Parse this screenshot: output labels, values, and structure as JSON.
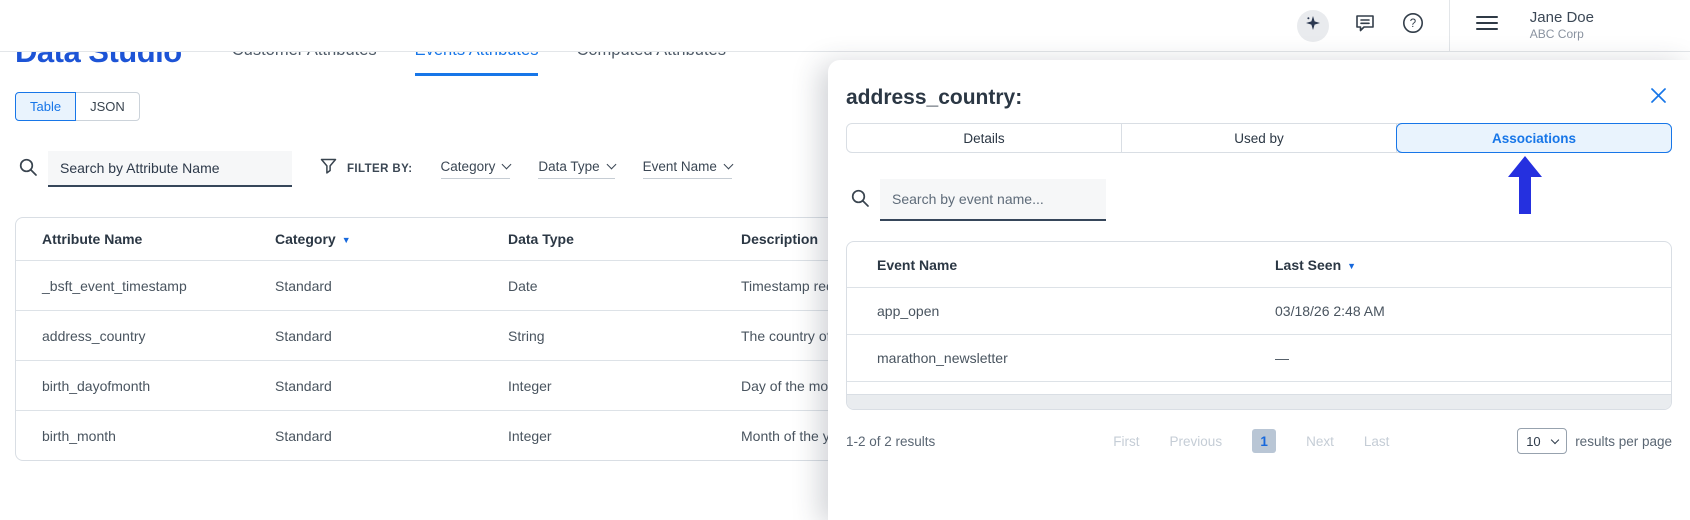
{
  "topbar": {
    "user_name": "Jane Doe",
    "user_org": "ABC Corp"
  },
  "page": {
    "title": "Data Studio",
    "nav_tabs": [
      {
        "label": "Customer Attributes",
        "active": false
      },
      {
        "label": "Events Attributes",
        "active": true
      },
      {
        "label": "Computed Attributes",
        "active": false
      }
    ],
    "view_toggle": {
      "table_label": "Table",
      "json_label": "JSON",
      "selected": "Table"
    },
    "search": {
      "value": "Search by Attribute Name"
    },
    "filter": {
      "label": "FILTER BY:",
      "dropdowns": [
        {
          "label": "Category"
        },
        {
          "label": "Data Type"
        },
        {
          "label": "Event Name"
        }
      ]
    },
    "attributes_table": {
      "columns": [
        "Attribute Name",
        "Category",
        "Data Type",
        "Description"
      ],
      "sorted_column": "Category",
      "sort_direction": "desc",
      "rows": [
        {
          "name": "_bsft_event_timestamp",
          "category": "Standard",
          "data_type": "Date",
          "description": "Timestamp recor"
        },
        {
          "name": "address_country",
          "category": "Standard",
          "data_type": "String",
          "description": "The country of th"
        },
        {
          "name": "birth_dayofmonth",
          "category": "Standard",
          "data_type": "Integer",
          "description": "Day of the month"
        },
        {
          "name": "birth_month",
          "category": "Standard",
          "data_type": "Integer",
          "description": "Month of the yea"
        }
      ]
    }
  },
  "modal": {
    "title": "address_country:",
    "tabs": [
      {
        "label": "Details",
        "active": false
      },
      {
        "label": "Used by",
        "active": false
      },
      {
        "label": "Associations",
        "active": true
      }
    ],
    "search_placeholder": "Search by event name...",
    "events_table": {
      "columns": [
        "Event Name",
        "Last Seen"
      ],
      "sorted_column": "Last Seen",
      "sort_direction": "desc",
      "rows": [
        {
          "event_name": "app_open",
          "last_seen": "03/18/26 2:48 AM"
        },
        {
          "event_name": "marathon_newsletter",
          "last_seen": "—"
        }
      ]
    },
    "pagination": {
      "summary": "1-2 of 2 results",
      "first_label": "First",
      "previous_label": "Previous",
      "current_page": "1",
      "next_label": "Next",
      "last_label": "Last",
      "per_page_value": "10",
      "per_page_label": "results per page"
    }
  },
  "icons": {
    "sparkle": "✦",
    "chat": "speech-bubble",
    "help": "?",
    "menu": "hamburger",
    "close": "✕",
    "search": "magnifier",
    "filter": "funnel",
    "sort_desc": "▼",
    "select_chevron": "⌄",
    "annotation_arrow": "↑"
  },
  "colors": {
    "accent_blue": "#1776e8",
    "logo_blue": "#1d54d6",
    "arrow_blue": "#2530df",
    "tab_selected_bg": "#e9f3fd",
    "page_box_bg": "#b9c6d5"
  }
}
